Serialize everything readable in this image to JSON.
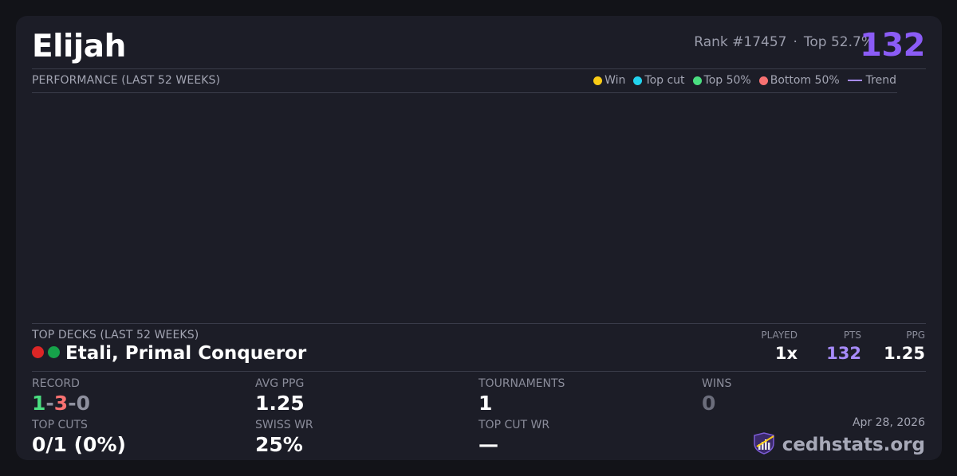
{
  "player": {
    "name": "Elijah",
    "rank_text": "Rank #17457",
    "separator": "·",
    "top_percent_text": "Top 52.7%",
    "score": "132"
  },
  "performance": {
    "label": "PERFORMANCE (LAST 52 WEEKS)",
    "legend": [
      {
        "label": "Win",
        "color": "#facc15"
      },
      {
        "label": "Top cut",
        "color": "#22d3ee"
      },
      {
        "label": "Top 50%",
        "color": "#4ade80"
      },
      {
        "label": "Bottom 50%",
        "color": "#f87171"
      },
      {
        "label": "Trend",
        "color": "#a78bfa"
      }
    ]
  },
  "top_decks": {
    "label": "TOP DECKS (LAST 52 WEEKS)",
    "columns": {
      "played": "PLAYED",
      "pts": "PTS",
      "ppg": "PPG"
    },
    "deck": {
      "name": "Etali, Primal Conqueror",
      "colors": [
        "#dc2626",
        "#16a34a"
      ],
      "played": "1x",
      "pts": "132",
      "ppg": "1.25"
    }
  },
  "stats": {
    "record_label": "RECORD",
    "record": {
      "wins": "1",
      "losses": "3",
      "draws": "0",
      "sep": "-"
    },
    "avg_ppg_label": "AVG PPG",
    "avg_ppg": "1.25",
    "tournaments_label": "TOURNAMENTS",
    "tournaments": "1",
    "wins_label": "WINS",
    "wins": "0",
    "top_cuts_label": "TOP CUTS",
    "top_cuts": "0/1 (0%)",
    "swiss_wr_label": "SWISS WR",
    "swiss_wr": "25%",
    "top_cut_wr_label": "TOP CUT WR",
    "top_cut_wr": "—"
  },
  "footer": {
    "date": "Apr 28, 2026",
    "brand": "cedhstats.org",
    "brand_icon": "bar-chart-shield-icon"
  }
}
